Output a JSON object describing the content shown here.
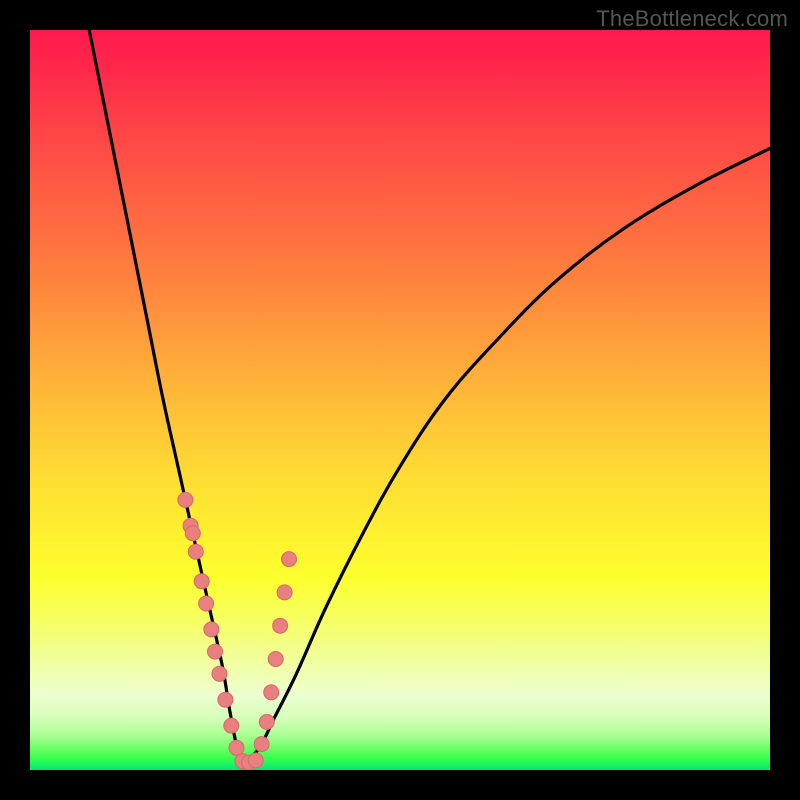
{
  "watermark": "TheBottleneck.com",
  "colors": {
    "background": "#000000",
    "curve": "#000000",
    "marker_fill": "#e98080",
    "marker_stroke": "#d86868"
  },
  "chart_data": {
    "type": "line",
    "title": "",
    "xlabel": "",
    "ylabel": "",
    "xlim": [
      0,
      100
    ],
    "ylim": [
      0,
      100
    ],
    "grid": false,
    "description": "Bottleneck V-curve: two curves descending from top toward a minimum near x≈29, with scatter points clustered along both branches near the bottom.",
    "series": [
      {
        "name": "left-branch",
        "x": [
          8,
          10,
          12,
          14,
          16,
          18,
          20,
          22,
          24,
          26,
          27,
          28,
          29
        ],
        "y": [
          100,
          90,
          80,
          70,
          60,
          50,
          41,
          32,
          23,
          14,
          8,
          3,
          1
        ]
      },
      {
        "name": "right-branch",
        "x": [
          29,
          31,
          33,
          36,
          40,
          45,
          50,
          56,
          63,
          71,
          80,
          90,
          100
        ],
        "y": [
          1,
          3,
          7,
          13,
          22,
          32,
          41,
          50,
          58,
          66,
          73,
          79,
          84
        ]
      }
    ],
    "scatter": {
      "name": "data-points",
      "x": [
        21.0,
        21.7,
        22.4,
        22.0,
        23.2,
        23.8,
        24.5,
        25.0,
        25.6,
        26.4,
        27.2,
        27.9,
        28.7,
        29.6,
        30.5,
        31.3,
        32.0,
        32.6,
        33.2,
        33.8,
        34.4,
        35.0
      ],
      "y": [
        36.5,
        33.0,
        29.5,
        32.0,
        25.5,
        22.5,
        19.0,
        16.0,
        13.0,
        9.5,
        6.0,
        3.0,
        1.2,
        1.0,
        1.3,
        3.5,
        6.5,
        10.5,
        15.0,
        19.5,
        24.0,
        28.5
      ]
    }
  }
}
